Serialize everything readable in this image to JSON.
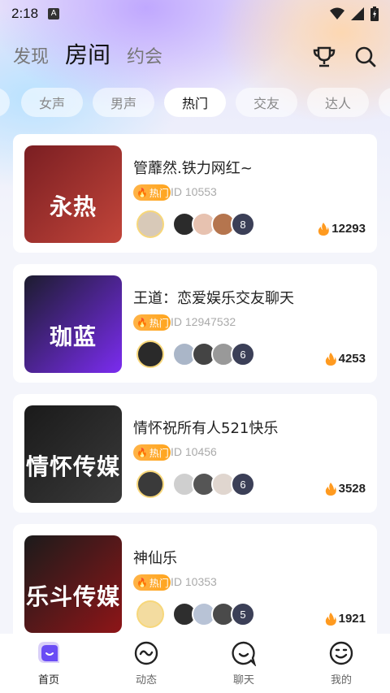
{
  "status": {
    "time": "2:18",
    "notif_letter": "A"
  },
  "topnav": {
    "tabs": [
      {
        "label": "发现",
        "active": false
      },
      {
        "label": "房间",
        "active": true
      },
      {
        "label": "约会",
        "active": false
      }
    ],
    "icons": [
      "trophy-icon",
      "search-icon"
    ]
  },
  "categories": [
    {
      "label": "女声",
      "active": false
    },
    {
      "label": "男声",
      "active": false
    },
    {
      "label": "热门",
      "active": true
    },
    {
      "label": "交友",
      "active": false
    },
    {
      "label": "达人",
      "active": false
    }
  ],
  "rooms": [
    {
      "cover_text": "永热",
      "cover_colors": [
        "#7a1e22",
        "#c2453a"
      ],
      "title": "管蘼然.铁力网红~",
      "badge": "热门",
      "room_id": "ID 10553",
      "audience_count": "8",
      "heat": "12293"
    },
    {
      "cover_text": "珈蓝",
      "cover_colors": [
        "#1c1c2e",
        "#7b2cf0"
      ],
      "title": "王道：恋爱娱乐交友聊天",
      "badge": "热门",
      "room_id": "ID 12947532",
      "audience_count": "6",
      "heat": "4253"
    },
    {
      "cover_text": "情怀传媒",
      "cover_colors": [
        "#1a1a1a",
        "#3a3a3a"
      ],
      "title": "情怀祝所有人521快乐",
      "badge": "热门",
      "room_id": "ID 10456",
      "audience_count": "6",
      "heat": "3528"
    },
    {
      "cover_text": "乐斗传媒",
      "cover_colors": [
        "#1b1b1b",
        "#8e1518"
      ],
      "title": "神仙乐",
      "badge": "热门",
      "room_id": "ID 10353",
      "audience_count": "5",
      "heat": "1921"
    }
  ],
  "tabbar": [
    {
      "label": "首页",
      "icon": "home-icon",
      "active": true
    },
    {
      "label": "动态",
      "icon": "wave-icon",
      "active": false
    },
    {
      "label": "聊天",
      "icon": "chat-icon",
      "active": false
    },
    {
      "label": "我的",
      "icon": "profile-icon",
      "active": false
    }
  ],
  "colors": {
    "accent": "#6a4cf5",
    "hot": "#ffa41c",
    "heat_flame": "#ff9a1f"
  }
}
